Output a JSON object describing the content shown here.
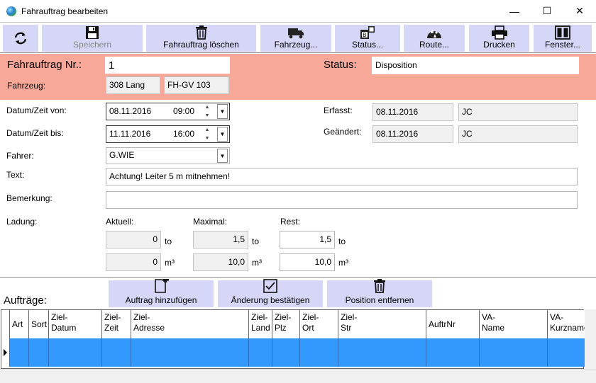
{
  "window": {
    "title": "Fahrauftrag bearbeiten",
    "minimize": "—",
    "maximize": "☐",
    "close": "✕"
  },
  "toolbar": {
    "refresh_label": "",
    "save_label": "Speichern",
    "delete_label": "Fahrauftrag löschen",
    "vehicle_label": "Fahrzeug...",
    "status_label": "Status...",
    "route_label": "Route...",
    "print_label": "Drucken",
    "window_label": "Fenster..."
  },
  "header": {
    "order_no_label": "Fahrauftrag Nr.:",
    "order_no": "1",
    "status_label": "Status:",
    "status": "Disposition",
    "vehicle_label": "Fahrzeug:",
    "vehicle_name": "308 Lang",
    "vehicle_plate": "FH-GV 103"
  },
  "form": {
    "from_label": "Datum/Zeit von:",
    "from_date": "08.11.2016",
    "from_time": "09:00",
    "to_label": "Datum/Zeit bis:",
    "to_date": "11.11.2016",
    "to_time": "16:00",
    "created_label": "Erfasst:",
    "created_date": "08.11.2016",
    "created_by": "JC",
    "changed_label": "Geändert:",
    "changed_date": "08.11.2016",
    "changed_by": "JC",
    "driver_label": "Fahrer:",
    "driver": "G.WIE",
    "text_label": "Text:",
    "text": "Achtung! Leiter 5 m mitnehmen!",
    "remark_label": "Bemerkung:",
    "remark": ""
  },
  "load": {
    "label": "Ladung:",
    "current_label": "Aktuell:",
    "max_label": "Maximal:",
    "rest_label": "Rest:",
    "current_t": "0",
    "max_t": "1,5",
    "rest_t": "1,5",
    "current_m3": "0",
    "max_m3": "10,0",
    "rest_m3": "10,0",
    "unit_t": "to",
    "unit_m3": "m³"
  },
  "orders": {
    "label": "Aufträge:",
    "add_label": "Auftrag hinzufügen",
    "confirm_label": "Änderung bestätigen",
    "remove_label": "Position entfernen",
    "columns": [
      "Art",
      "Sort",
      "Ziel-\nDatum",
      "Ziel-\nZeit",
      "Ziel-\nAdresse",
      "Ziel-\nLand",
      "Ziel-\nPlz",
      "Ziel-\nOrt",
      "Ziel-\nStr",
      "AuftrNr",
      "VA-\nName",
      "VA-\nKurzname"
    ]
  },
  "colors": {
    "header_bg": "#f8a898",
    "button_bg": "#d6d6f8",
    "selected_row": "#3399ff"
  }
}
